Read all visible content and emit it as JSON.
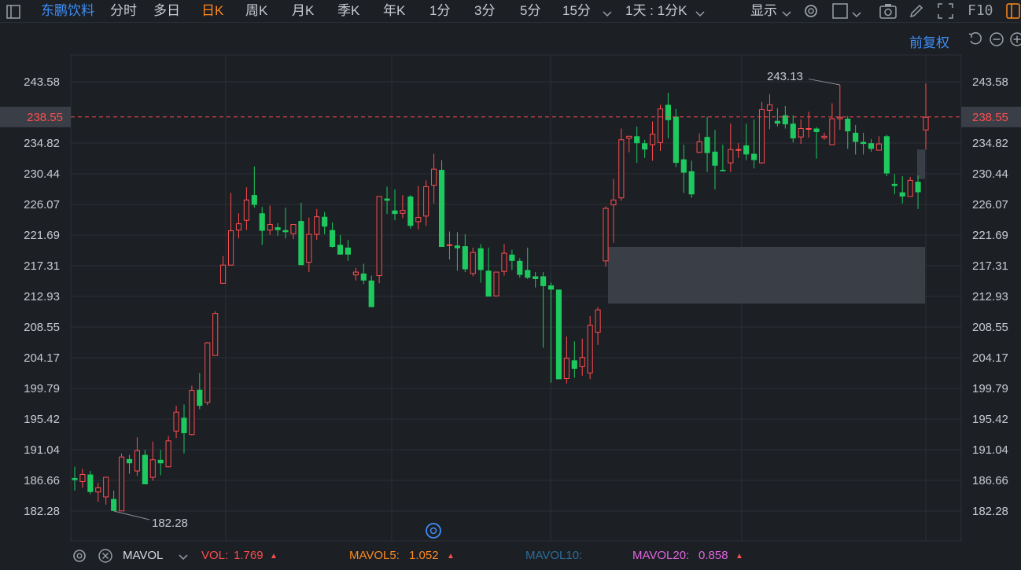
{
  "toolbar": {
    "stock_name": "东鹏饮料",
    "periods": [
      "分时",
      "多日",
      "日K",
      "周K",
      "月K",
      "季K",
      "年K",
      "1分",
      "3分",
      "5分",
      "15分"
    ],
    "active_period": "日K",
    "intraday_mode": "1天 : 1分K",
    "display_label": "显示",
    "f10_label": "F10"
  },
  "sub_toolbar": {
    "adjust_label": "前复权"
  },
  "colors": {
    "up": "#ff4d4f",
    "down": "#1ec95f",
    "background": "#1c1f24",
    "grid": "#2c3038",
    "current_price": "#ff4d4f",
    "axis_text": "#c8ccd2",
    "highlight": "#3e8ef7",
    "active_tab": "#ff8a1f"
  },
  "chart_data": {
    "type": "candlestick",
    "y_ticks": [
      "243.58",
      "234.82",
      "230.44",
      "226.07",
      "221.69",
      "217.31",
      "212.93",
      "208.55",
      "204.17",
      "199.79",
      "195.42",
      "191.04",
      "186.66",
      "182.28"
    ],
    "ylim": [
      182.28,
      243.58
    ],
    "current_price": "238.55",
    "current_price_value": 238.55,
    "max_label": "243.13",
    "min_label": "182.28",
    "candles": [
      {
        "o": 187.0,
        "h": 188.6,
        "l": 185.2,
        "c": 186.7
      },
      {
        "o": 186.5,
        "h": 188.3,
        "l": 185.6,
        "c": 187.5
      },
      {
        "o": 187.5,
        "h": 188.0,
        "l": 184.7,
        "c": 185.0
      },
      {
        "o": 185.0,
        "h": 186.3,
        "l": 183.6,
        "c": 185.6
      },
      {
        "o": 184.3,
        "h": 187.1,
        "l": 183.2,
        "c": 187.1
      },
      {
        "o": 184.0,
        "h": 185.2,
        "l": 182.28,
        "c": 182.3
      },
      {
        "o": 182.3,
        "h": 190.5,
        "l": 182.3,
        "c": 190.0
      },
      {
        "o": 189.7,
        "h": 190.3,
        "l": 187.6,
        "c": 189.1
      },
      {
        "o": 188.0,
        "h": 192.8,
        "l": 187.3,
        "c": 190.9
      },
      {
        "o": 190.3,
        "h": 191.0,
        "l": 186.1,
        "c": 186.1
      },
      {
        "o": 187.1,
        "h": 192.2,
        "l": 186.6,
        "c": 189.6
      },
      {
        "o": 189.6,
        "h": 191.0,
        "l": 187.4,
        "c": 189.1
      },
      {
        "o": 188.6,
        "h": 193.0,
        "l": 188.5,
        "c": 192.3
      },
      {
        "o": 193.7,
        "h": 197.3,
        "l": 192.7,
        "c": 196.4
      },
      {
        "o": 195.6,
        "h": 197.5,
        "l": 190.5,
        "c": 193.4
      },
      {
        "o": 193.2,
        "h": 200.2,
        "l": 193.1,
        "c": 199.5
      },
      {
        "o": 199.6,
        "h": 202.0,
        "l": 196.8,
        "c": 197.3
      },
      {
        "o": 197.8,
        "h": 206.4,
        "l": 197.4,
        "c": 206.3
      },
      {
        "o": 204.5,
        "h": 210.8,
        "l": 204.5,
        "c": 210.5
      },
      {
        "o": 214.8,
        "h": 218.7,
        "l": 214.8,
        "c": 217.4
      },
      {
        "o": 217.4,
        "h": 227.7,
        "l": 217.4,
        "c": 222.3
      },
      {
        "o": 222.4,
        "h": 224.8,
        "l": 221.2,
        "c": 223.3
      },
      {
        "o": 223.8,
        "h": 228.5,
        "l": 222.4,
        "c": 226.7
      },
      {
        "o": 227.4,
        "h": 231.5,
        "l": 225.6,
        "c": 226.0
      },
      {
        "o": 224.8,
        "h": 225.7,
        "l": 220.3,
        "c": 222.3
      },
      {
        "o": 222.4,
        "h": 225.9,
        "l": 221.7,
        "c": 223.2
      },
      {
        "o": 222.8,
        "h": 223.4,
        "l": 221.6,
        "c": 222.4
      },
      {
        "o": 222.4,
        "h": 225.6,
        "l": 221.2,
        "c": 222.1
      },
      {
        "o": 221.9,
        "h": 223.2,
        "l": 221.1,
        "c": 223.2
      },
      {
        "o": 223.7,
        "h": 226.3,
        "l": 217.4,
        "c": 217.4
      },
      {
        "o": 217.8,
        "h": 224.2,
        "l": 216.4,
        "c": 221.8
      },
      {
        "o": 221.8,
        "h": 225.4,
        "l": 221.0,
        "c": 224.3
      },
      {
        "o": 224.3,
        "h": 225.0,
        "l": 221.8,
        "c": 222.9
      },
      {
        "o": 222.4,
        "h": 223.5,
        "l": 219.9,
        "c": 220.0
      },
      {
        "o": 220.3,
        "h": 221.7,
        "l": 218.9,
        "c": 218.9
      },
      {
        "o": 219.9,
        "h": 221.0,
        "l": 218.0,
        "c": 218.9
      },
      {
        "o": 216.0,
        "h": 217.0,
        "l": 215.2,
        "c": 216.4
      },
      {
        "o": 216.2,
        "h": 217.6,
        "l": 214.7,
        "c": 215.2
      },
      {
        "o": 215.2,
        "h": 215.9,
        "l": 211.4,
        "c": 211.4
      },
      {
        "o": 215.9,
        "h": 227.2,
        "l": 214.8,
        "c": 227.2
      },
      {
        "o": 226.9,
        "h": 228.6,
        "l": 224.7,
        "c": 226.6
      },
      {
        "o": 225.2,
        "h": 228.2,
        "l": 223.8,
        "c": 224.7
      },
      {
        "o": 224.8,
        "h": 227.4,
        "l": 224.1,
        "c": 225.2
      },
      {
        "o": 227.2,
        "h": 227.4,
        "l": 222.6,
        "c": 223.0
      },
      {
        "o": 223.6,
        "h": 228.7,
        "l": 222.5,
        "c": 224.2
      },
      {
        "o": 224.4,
        "h": 229.5,
        "l": 223.0,
        "c": 228.6
      },
      {
        "o": 228.8,
        "h": 233.3,
        "l": 226.2,
        "c": 231.1
      },
      {
        "o": 231.0,
        "h": 232.4,
        "l": 220.0,
        "c": 220.0
      },
      {
        "o": 220.2,
        "h": 222.2,
        "l": 218.2,
        "c": 220.3
      },
      {
        "o": 220.2,
        "h": 222.1,
        "l": 216.6,
        "c": 219.8
      },
      {
        "o": 220.1,
        "h": 221.8,
        "l": 216.4,
        "c": 216.8
      },
      {
        "o": 216.2,
        "h": 219.9,
        "l": 215.8,
        "c": 219.2
      },
      {
        "o": 219.8,
        "h": 220.4,
        "l": 214.9,
        "c": 216.7
      },
      {
        "o": 216.6,
        "h": 219.9,
        "l": 213.5,
        "c": 212.9
      },
      {
        "o": 213.0,
        "h": 214.4,
        "l": 213.0,
        "c": 216.4
      },
      {
        "o": 216.5,
        "h": 220.4,
        "l": 215.9,
        "c": 219.1
      },
      {
        "o": 218.9,
        "h": 219.6,
        "l": 216.7,
        "c": 218.0
      },
      {
        "o": 218.0,
        "h": 218.4,
        "l": 215.6,
        "c": 216.0
      },
      {
        "o": 216.7,
        "h": 219.9,
        "l": 215.4,
        "c": 215.6
      },
      {
        "o": 215.8,
        "h": 216.4,
        "l": 214.2,
        "c": 215.4
      },
      {
        "o": 215.8,
        "h": 216.4,
        "l": 205.6,
        "c": 214.4
      },
      {
        "o": 214.5,
        "h": 214.9,
        "l": 200.6,
        "c": 213.9
      },
      {
        "o": 213.9,
        "h": 213.9,
        "l": 201.1,
        "c": 201.1
      },
      {
        "o": 201.2,
        "h": 207.2,
        "l": 200.5,
        "c": 204.1
      },
      {
        "o": 203.8,
        "h": 206.5,
        "l": 201.3,
        "c": 202.6
      },
      {
        "o": 202.9,
        "h": 206.9,
        "l": 201.6,
        "c": 204.2
      },
      {
        "o": 202.0,
        "h": 210.1,
        "l": 201.1,
        "c": 208.8
      },
      {
        "o": 207.8,
        "h": 211.4,
        "l": 206.0,
        "c": 211.0
      },
      {
        "o": 218.0,
        "h": 225.8,
        "l": 217.2,
        "c": 225.5
      },
      {
        "o": 226.0,
        "h": 229.7,
        "l": 220.6,
        "c": 226.7
      },
      {
        "o": 227.0,
        "h": 236.9,
        "l": 226.6,
        "c": 235.3
      },
      {
        "o": 235.5,
        "h": 235.7,
        "l": 233.5,
        "c": 235.8
      },
      {
        "o": 235.8,
        "h": 237.2,
        "l": 232.0,
        "c": 234.8
      },
      {
        "o": 234.8,
        "h": 235.3,
        "l": 232.7,
        "c": 233.9
      },
      {
        "o": 234.6,
        "h": 237.9,
        "l": 232.3,
        "c": 236.1
      },
      {
        "o": 234.9,
        "h": 240.3,
        "l": 233.7,
        "c": 239.7
      },
      {
        "o": 240.3,
        "h": 242.0,
        "l": 235.5,
        "c": 238.1
      },
      {
        "o": 238.6,
        "h": 239.7,
        "l": 231.4,
        "c": 232.0
      },
      {
        "o": 232.5,
        "h": 234.6,
        "l": 227.7,
        "c": 230.6
      },
      {
        "o": 230.8,
        "h": 232.3,
        "l": 227.0,
        "c": 227.5
      },
      {
        "o": 233.5,
        "h": 236.2,
        "l": 233.4,
        "c": 235.0
      },
      {
        "o": 235.7,
        "h": 238.6,
        "l": 230.7,
        "c": 233.4
      },
      {
        "o": 233.6,
        "h": 236.7,
        "l": 228.2,
        "c": 231.6
      },
      {
        "o": 231.0,
        "h": 234.6,
        "l": 230.8,
        "c": 230.8
      },
      {
        "o": 232.0,
        "h": 237.6,
        "l": 230.7,
        "c": 233.9
      },
      {
        "o": 233.9,
        "h": 234.8,
        "l": 232.7,
        "c": 233.9
      },
      {
        "o": 234.5,
        "h": 237.6,
        "l": 232.4,
        "c": 233.2
      },
      {
        "o": 233.3,
        "h": 238.2,
        "l": 231.2,
        "c": 232.4
      },
      {
        "o": 232.0,
        "h": 240.7,
        "l": 231.9,
        "c": 239.6
      },
      {
        "o": 239.5,
        "h": 241.8,
        "l": 236.8,
        "c": 240.3
      },
      {
        "o": 238.0,
        "h": 239.8,
        "l": 237.2,
        "c": 237.6
      },
      {
        "o": 238.8,
        "h": 240.1,
        "l": 236.9,
        "c": 237.5
      },
      {
        "o": 237.6,
        "h": 238.8,
        "l": 234.9,
        "c": 235.5
      },
      {
        "o": 235.7,
        "h": 238.2,
        "l": 234.7,
        "c": 236.9
      },
      {
        "o": 236.9,
        "h": 239.3,
        "l": 235.6,
        "c": 236.9
      },
      {
        "o": 236.9,
        "h": 237.1,
        "l": 232.6,
        "c": 236.4
      },
      {
        "o": 235.6,
        "h": 236.3,
        "l": 235.3,
        "c": 235.8
      },
      {
        "o": 234.6,
        "h": 240.5,
        "l": 234.7,
        "c": 238.3
      },
      {
        "o": 238.3,
        "h": 243.13,
        "l": 236.7,
        "c": 238.5
      },
      {
        "o": 238.3,
        "h": 238.7,
        "l": 234.0,
        "c": 236.5
      },
      {
        "o": 236.3,
        "h": 237.4,
        "l": 233.2,
        "c": 235.0
      },
      {
        "o": 235.0,
        "h": 236.3,
        "l": 233.2,
        "c": 234.7
      },
      {
        "o": 234.8,
        "h": 235.4,
        "l": 233.6,
        "c": 234.0
      },
      {
        "o": 233.8,
        "h": 235.8,
        "l": 234.1,
        "c": 234.7
      },
      {
        "o": 235.8,
        "h": 236.0,
        "l": 230.1,
        "c": 230.5
      },
      {
        "o": 229.0,
        "h": 230.4,
        "l": 227.5,
        "c": 228.7
      },
      {
        "o": 227.8,
        "h": 230.1,
        "l": 226.2,
        "c": 227.2
      },
      {
        "o": 227.2,
        "h": 230.0,
        "l": 227.2,
        "c": 229.5
      },
      {
        "o": 229.3,
        "h": 230.2,
        "l": 225.4,
        "c": 227.8
      },
      {
        "o": 236.7,
        "h": 243.33,
        "l": 233.9,
        "c": 238.5
      }
    ],
    "gaps": [
      {
        "top": 220.0,
        "bottom": 211.9
      },
      {
        "top": 233.9,
        "bottom": 229.7
      }
    ]
  },
  "indicator": {
    "name": "MAVOL",
    "vol_label": "VOL:",
    "vol_value": "1.769",
    "ma5_label": "MAVOL5:",
    "ma5_value": "1.052",
    "ma10_label": "MAVOL10:",
    "ma20_label": "MAVOL20:",
    "ma20_value": "0.858",
    "vol_color": "#ff4d4f",
    "ma5_color": "#ff8a1f",
    "ma10_color": "#2b6f9a",
    "ma20_color": "#e066e0"
  }
}
